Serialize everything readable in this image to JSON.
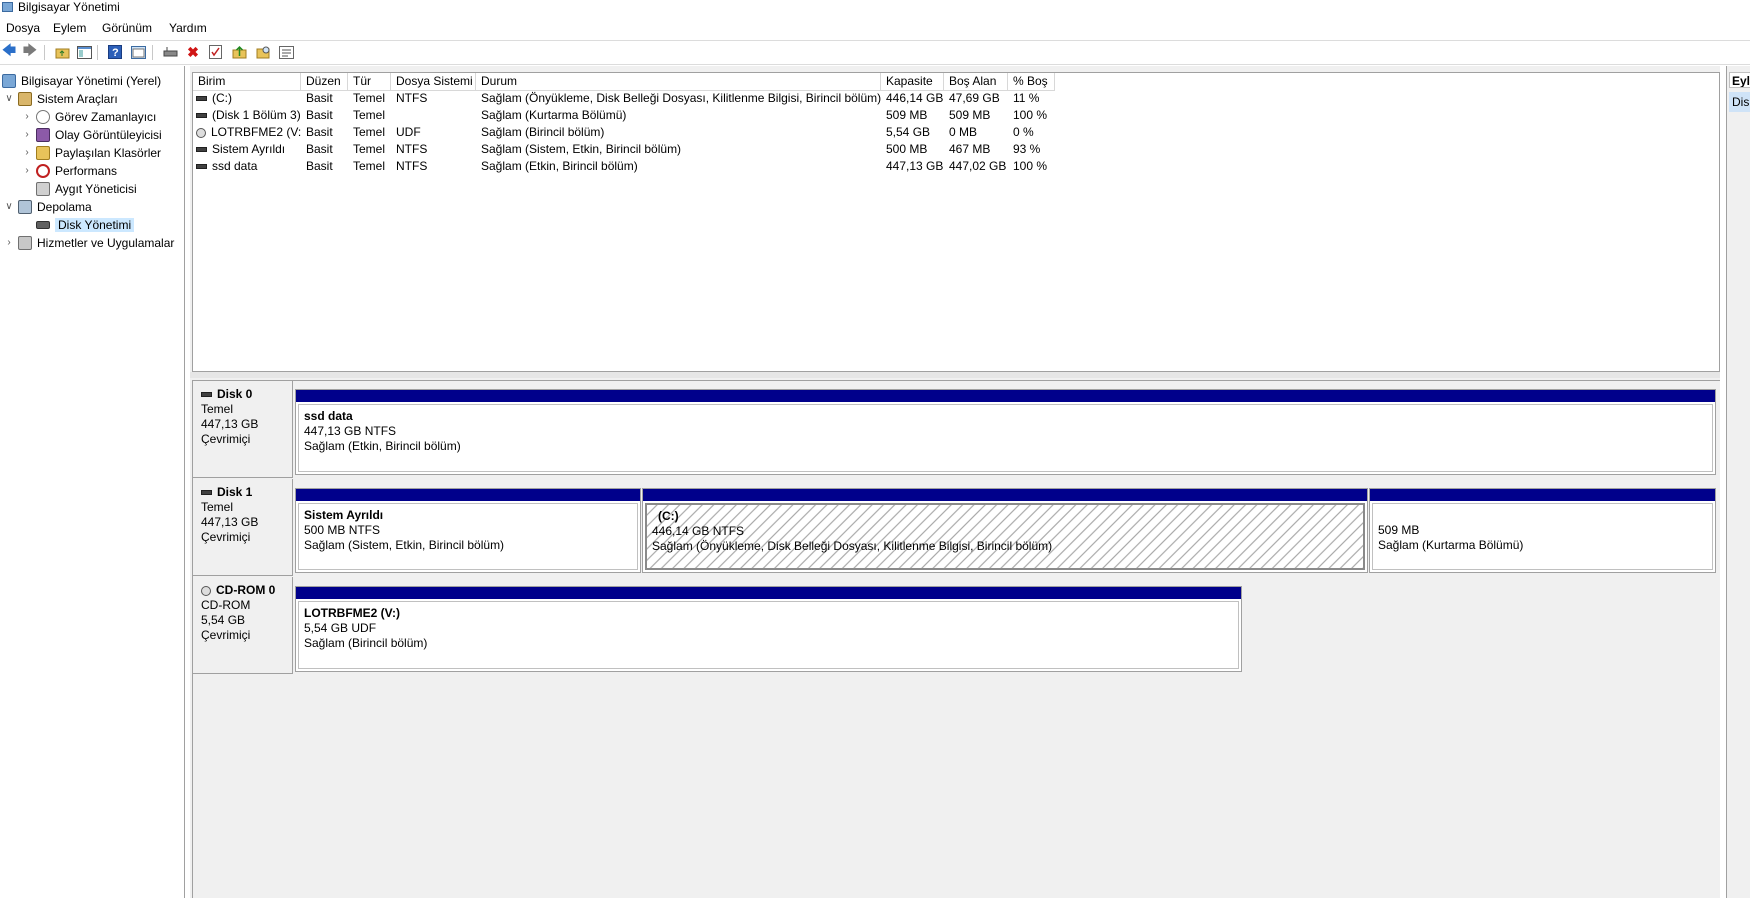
{
  "window": {
    "title": "Bilgisayar Yönetimi"
  },
  "menu": {
    "items": [
      "Dosya",
      "Eylem",
      "Görünüm",
      "Yardım"
    ]
  },
  "tree": {
    "root": "Bilgisayar Yönetimi (Yerel)",
    "system_tools": "Sistem Araçları",
    "task_scheduler": "Görev Zamanlayıcı",
    "event_viewer": "Olay Görüntüleyicisi",
    "shared_folders": "Paylaşılan Klasörler",
    "performance": "Performans",
    "device_manager": "Aygıt Yöneticisi",
    "storage": "Depolama",
    "disk_management": "Disk Yönetimi",
    "services": "Hizmetler ve Uygulamalar"
  },
  "volumes": {
    "headers": [
      "Birim",
      "Düzen",
      "Tür",
      "Dosya Sistemi",
      "Durum",
      "Kapasite",
      "Boş Alan",
      "% Boş"
    ],
    "rows": [
      [
        "(C:)",
        "Basit",
        "Temel",
        "NTFS",
        "Sağlam (Önyükleme, Disk Belleği Dosyası, Kilitlenme Bilgisi, Birincil bölüm)",
        "446,14 GB",
        "47,69 GB",
        "11 %"
      ],
      [
        "(Disk 1 Bölüm 3)",
        "Basit",
        "Temel",
        "",
        "Sağlam (Kurtarma Bölümü)",
        "509 MB",
        "509 MB",
        "100 %"
      ],
      [
        "LOTRBFME2 (V:)",
        "Basit",
        "Temel",
        "UDF",
        "Sağlam (Birincil bölüm)",
        "5,54 GB",
        "0 MB",
        "0 %"
      ],
      [
        "Sistem Ayrıldı",
        "Basit",
        "Temel",
        "NTFS",
        "Sağlam (Sistem, Etkin, Birincil bölüm)",
        "500 MB",
        "467 MB",
        "93 %"
      ],
      [
        "ssd data",
        "Basit",
        "Temel",
        "NTFS",
        "Sağlam (Etkin, Birincil bölüm)",
        "447,13 GB",
        "447,02 GB",
        "100 %"
      ]
    ]
  },
  "disks": {
    "disk0": {
      "name": "Disk 0",
      "type": "Temel",
      "size": "447,13 GB",
      "status": "Çevrimiçi",
      "p1": {
        "name": "ssd data",
        "fs": "447,13 GB NTFS",
        "state": "Sağlam (Etkin, Birincil bölüm)"
      }
    },
    "disk1": {
      "name": "Disk 1",
      "type": "Temel",
      "size": "447,13 GB",
      "status": "Çevrimiçi",
      "p1": {
        "name": "Sistem Ayrıldı",
        "fs": "500 MB NTFS",
        "state": "Sağlam (Sistem, Etkin, Birincil bölüm)"
      },
      "p2": {
        "name": "(C:)",
        "fs": "446,14 GB NTFS",
        "state": "Sağlam (Önyükleme, Disk Belleği Dosyası, Kilitlenme Bilgisi, Birincil bölüm)"
      },
      "p3": {
        "fs": "509 MB",
        "state": "Sağlam (Kurtarma Bölümü)"
      }
    },
    "cdrom0": {
      "name": "CD-ROM 0",
      "type": "CD-ROM",
      "size": "5,54 GB",
      "status": "Çevrimiçi",
      "p1": {
        "name": "LOTRBFME2  (V:)",
        "fs": "5,54 GB UDF",
        "state": "Sağlam (Birincil bölüm)"
      }
    }
  },
  "actions": {
    "header": "Eylemler",
    "item": "Disk Yönetimi"
  },
  "colors": {
    "partition_bar": "#00008b",
    "selection": "#cce8ff"
  }
}
